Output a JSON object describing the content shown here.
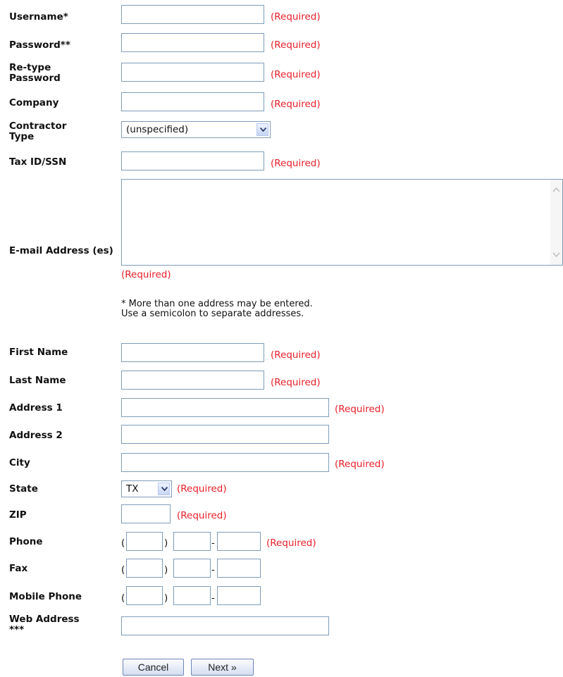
{
  "form": {
    "fields": {
      "username": {
        "label": "Username*",
        "required": "(Required)"
      },
      "password": {
        "label": "Password**",
        "required": "(Required)"
      },
      "retype_password": {
        "label": "Re-type Password",
        "required": "(Required)"
      },
      "company": {
        "label": "Company",
        "required": "(Required)"
      },
      "contractor_type": {
        "label": "Contractor Type",
        "selected": "(unspecified)"
      },
      "tax_id": {
        "label": "Tax ID/SSN",
        "required": "(Required)"
      },
      "email": {
        "label": "E-mail Address (es)",
        "required": "(Required)",
        "note_line1": "* More than one address may be entered.",
        "note_line2": "Use a semicolon to separate addresses."
      },
      "first_name": {
        "label": "First Name",
        "required": "(Required)"
      },
      "last_name": {
        "label": "Last Name",
        "required": "(Required)"
      },
      "address1": {
        "label": "Address 1",
        "required": "(Required)"
      },
      "address2": {
        "label": "Address 2"
      },
      "city": {
        "label": "City",
        "required": "(Required)"
      },
      "state": {
        "label": "State",
        "selected": "TX",
        "required": "(Required)"
      },
      "zip": {
        "label": "ZIP",
        "required": "(Required)"
      },
      "phone": {
        "label": "Phone",
        "required": "(Required)",
        "open_paren": "(",
        "close_paren": ")",
        "dash": "-"
      },
      "fax": {
        "label": "Fax",
        "open_paren": "(",
        "close_paren": ")",
        "dash": "-"
      },
      "mobile": {
        "label": "Mobile Phone",
        "open_paren": "(",
        "close_paren": ")",
        "dash": "-"
      },
      "web": {
        "label": "Web Address",
        "label_note": "***"
      }
    },
    "buttons": {
      "cancel": "Cancel",
      "next": "Next »"
    }
  },
  "colors": {
    "required": "#e8202a",
    "input_border": "#7f9db9"
  }
}
